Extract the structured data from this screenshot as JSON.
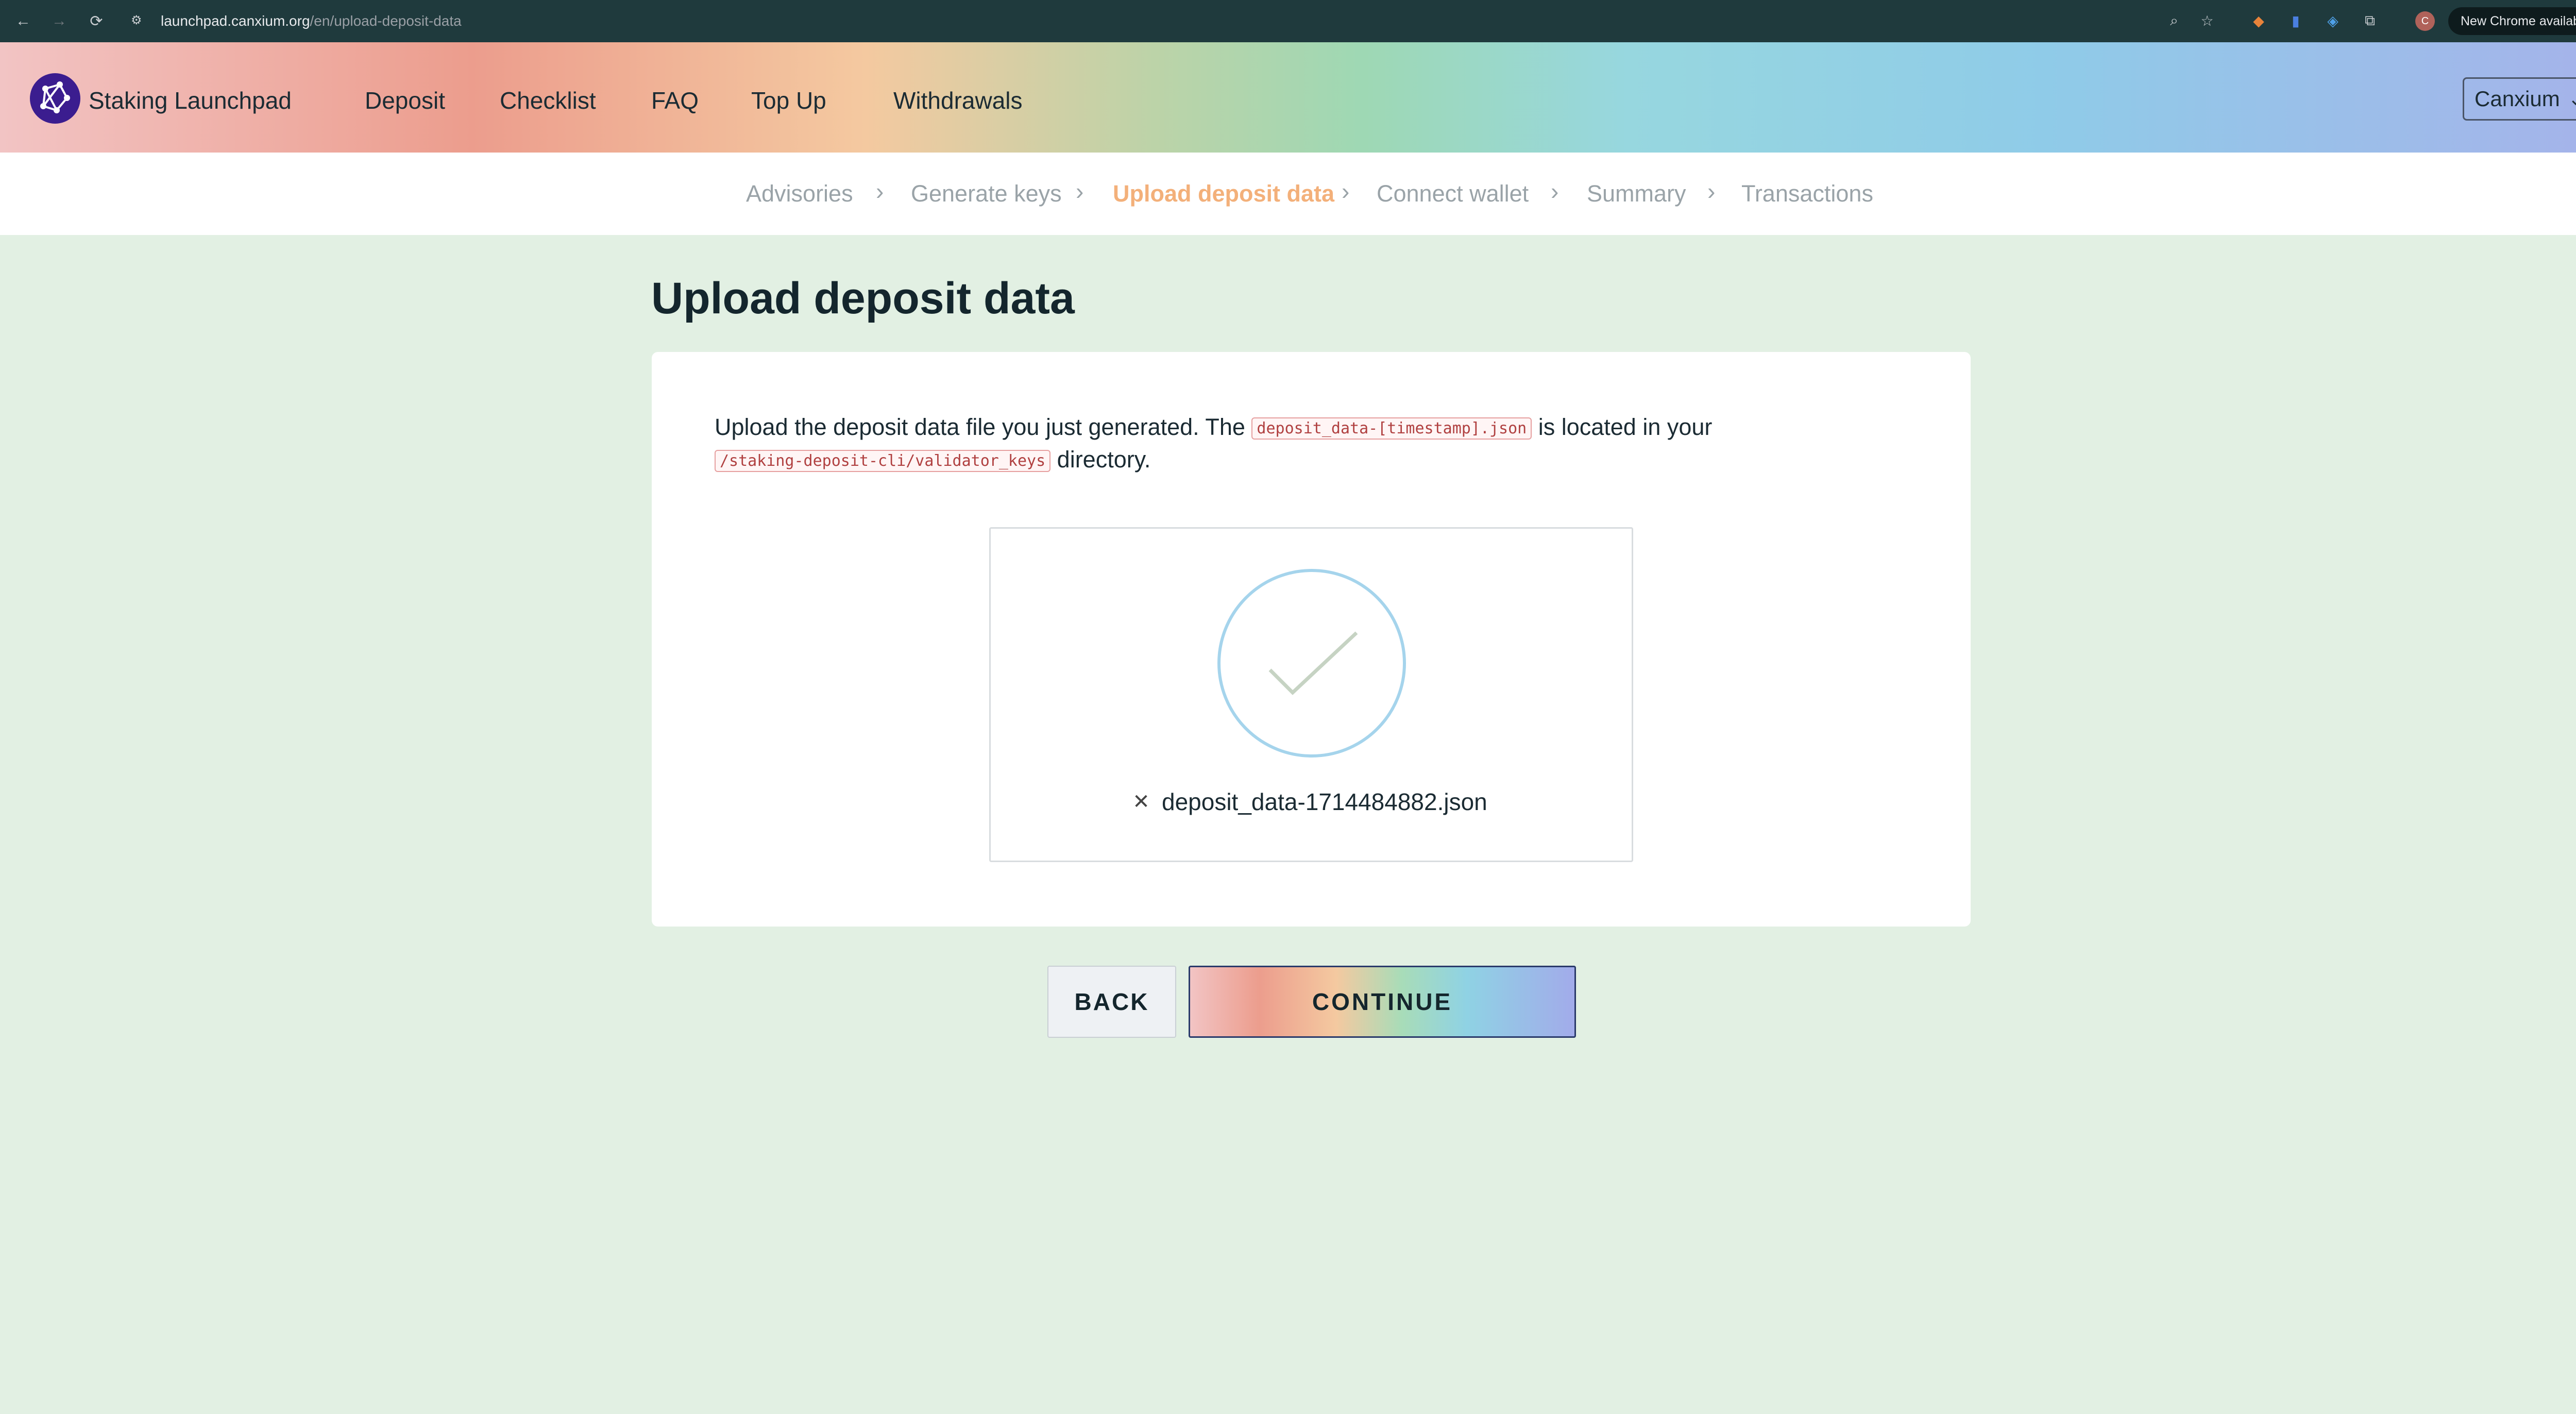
{
  "browser": {
    "url_host": "launchpad.canxium.org",
    "url_path": "/en/upload-deposit-data",
    "update_label": "New Chrome available",
    "profile_initial": "C"
  },
  "header": {
    "brand": "Staking Launchpad",
    "nav": [
      "Deposit",
      "Checklist",
      "FAQ",
      "Top Up",
      "Withdrawals"
    ],
    "network": "Canxium"
  },
  "stepper": {
    "steps": [
      "Advisories",
      "Generate keys",
      "Upload deposit data",
      "Connect wallet",
      "Summary",
      "Transactions"
    ],
    "active_index": 2
  },
  "main": {
    "title": "Upload deposit data",
    "intro_part1": "Upload the deposit data file you just generated. The",
    "file_pattern": "deposit_data-[timestamp].json",
    "intro_part2": "is located in your",
    "directory": "/staking-deposit-cli/validator_keys",
    "intro_part3": "directory.",
    "uploaded_file": "deposit_data-1714484882.json"
  },
  "actions": {
    "back": "BACK",
    "continue": "CONTINUE"
  },
  "colors": {
    "active_step": "#f3b07a",
    "page_bg": "#e2f0e3",
    "check_circle": "#a5d4ec",
    "logo": "#3b1d8f"
  }
}
